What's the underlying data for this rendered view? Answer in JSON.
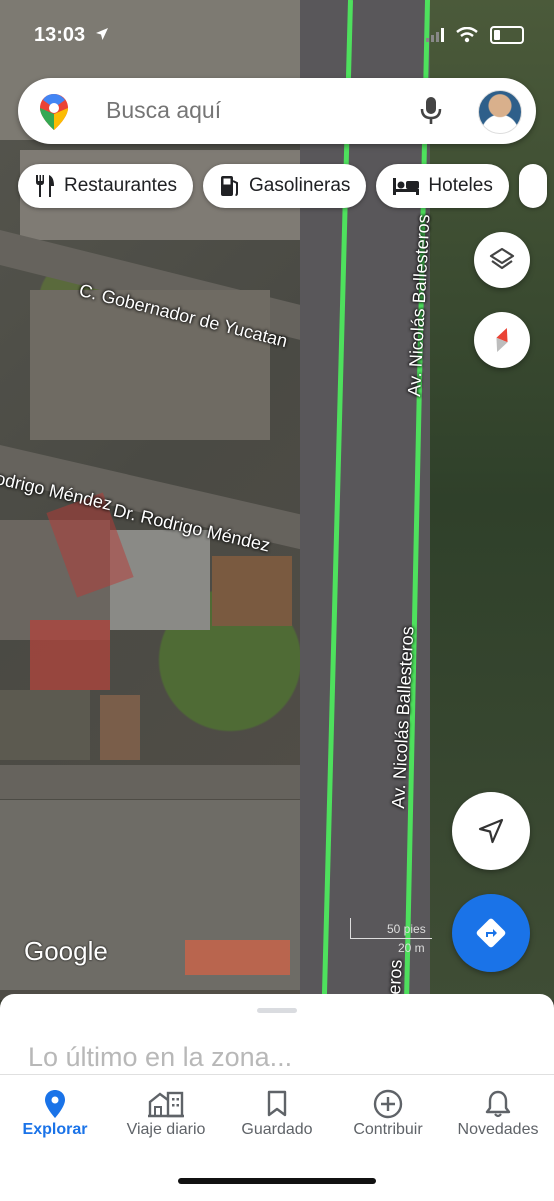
{
  "status_bar": {
    "time": "13:03"
  },
  "search": {
    "placeholder": "Busca aquí"
  },
  "chips": [
    {
      "label": "Restaurantes",
      "icon": "fork-knife-icon"
    },
    {
      "label": "Gasolineras",
      "icon": "gas-station-icon"
    },
    {
      "label": "Hoteles",
      "icon": "bed-icon"
    }
  ],
  "map": {
    "streets": {
      "gobernador": "C. Gobernador de Yucatan",
      "rodrigo_left": "odrigo Méndez",
      "rodrigo_right": "Dr. Rodrigo Méndez",
      "ballesteros_top": "Av. Nicolás Ballesteros",
      "ballesteros_mid": "Av. Nicolás Ballesteros",
      "ballesteros_bottom": "eros"
    },
    "attribution": "Google",
    "scale": {
      "feet": "50 pies",
      "meters": "20 m"
    },
    "route_color": "#4ee05d"
  },
  "sheet": {
    "title": "Lo último en la zona..."
  },
  "bottom_nav": [
    {
      "label": "Explorar",
      "icon": "location-pin-icon",
      "active": true
    },
    {
      "label": "Viaje diario",
      "icon": "commute-icon",
      "active": false
    },
    {
      "label": "Guardado",
      "icon": "bookmark-icon",
      "active": false
    },
    {
      "label": "Contribuir",
      "icon": "add-circle-icon",
      "active": false
    },
    {
      "label": "Novedades",
      "icon": "bell-icon",
      "active": false
    }
  ],
  "colors": {
    "accent": "#1a73e8",
    "directions_button": "#1a73e8"
  }
}
